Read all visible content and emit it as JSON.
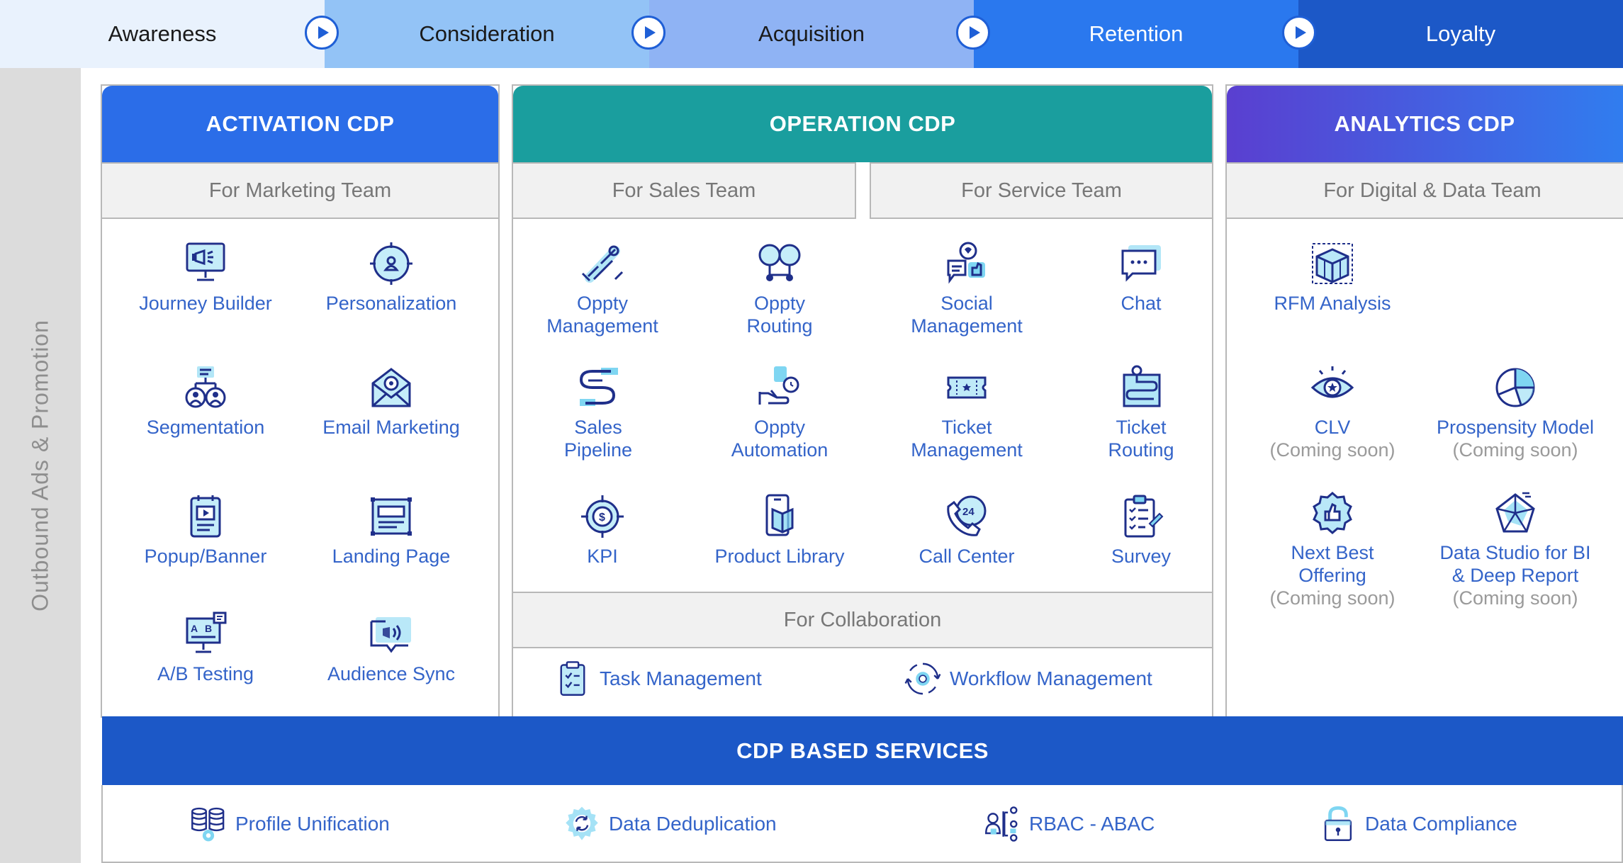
{
  "funnel": [
    {
      "label": "Awareness",
      "bg": "#e9f2fd",
      "fg": "#1a1a1a"
    },
    {
      "label": "Consideration",
      "bg": "#93c3f6",
      "fg": "#1a1a1a"
    },
    {
      "label": "Acquisition",
      "bg": "#8fb3f4",
      "fg": "#1a1a1a"
    },
    {
      "label": "Retention",
      "bg": "#2a78ee",
      "fg": "#ffffff"
    },
    {
      "label": "Loyalty",
      "bg": "#1c58c7",
      "fg": "#ffffff"
    }
  ],
  "side_label": "Outbound Ads & Promotion",
  "activation": {
    "title": "ACTIVATION CDP",
    "team": "For Marketing Team",
    "color": "#2b6de8",
    "items": [
      {
        "label": "Journey Builder",
        "icon": "monitor-megaphone-icon"
      },
      {
        "label": "Personalization",
        "icon": "user-target-icon"
      },
      {
        "label": "Segmentation",
        "icon": "segmentation-users-icon"
      },
      {
        "label": "Email Marketing",
        "icon": "email-at-icon"
      },
      {
        "label": "Popup/Banner",
        "icon": "popup-banner-icon"
      },
      {
        "label": "Landing Page",
        "icon": "landing-page-icon"
      },
      {
        "label": "A/B Testing",
        "icon": "ab-testing-icon"
      },
      {
        "label": "Audience Sync",
        "icon": "audience-sync-icon"
      }
    ]
  },
  "operation": {
    "title": "OPERATION CDP",
    "sales_team": "For Sales Team",
    "service_team": "For Service Team",
    "collab_team": "For Collaboration",
    "color": "#1a9e9e",
    "items": [
      {
        "label": "Oppty Management",
        "icon": "handshake-icon"
      },
      {
        "label": "Oppty Routing",
        "icon": "routing-icon"
      },
      {
        "label": "Social Management",
        "icon": "social-thumbs-icon"
      },
      {
        "label": "Chat",
        "icon": "chat-icon"
      },
      {
        "label": "Sales Pipeline",
        "icon": "pipeline-icon"
      },
      {
        "label": "Oppty Automation",
        "icon": "automation-hand-icon"
      },
      {
        "label": "Ticket Management",
        "icon": "ticket-icon"
      },
      {
        "label": "Ticket Routing",
        "icon": "ticket-routing-icon"
      },
      {
        "label": "KPI",
        "icon": "kpi-target-icon"
      },
      {
        "label": "Product Library",
        "icon": "product-library-icon"
      },
      {
        "label": "Call Center",
        "icon": "call-center-24-icon"
      },
      {
        "label": "Survey",
        "icon": "survey-clipboard-icon"
      }
    ],
    "collab": [
      {
        "label": "Task Management",
        "icon": "task-clipboard-icon"
      },
      {
        "label": "Workflow Management",
        "icon": "workflow-cycle-icon"
      }
    ]
  },
  "analytics": {
    "title": "ANALYTICS CDP",
    "team": "For Digital & Data Team",
    "color_from": "#5a3fd0",
    "color_to": "#2f7ff0",
    "items": [
      {
        "label": "RFM Analysis",
        "icon": "rfm-cube-icon",
        "note": ""
      },
      {
        "label": "CLV",
        "icon": "clv-eye-icon",
        "note": "(Coming soon)"
      },
      {
        "label": "Prospensity Model",
        "icon": "pie-chart-icon",
        "note": "(Coming soon)"
      },
      {
        "label": "Next Best Offering",
        "icon": "badge-thumbs-icon",
        "note": "(Coming soon)"
      },
      {
        "label": "Data Studio for BI & Deep Report",
        "icon": "radar-chart-icon",
        "note": "(Coming soon)"
      }
    ]
  },
  "services": {
    "title": "CDP BASED SERVICES",
    "color": "#1c58c7",
    "items": [
      {
        "label": "Profile Unification",
        "icon": "database-gear-icon"
      },
      {
        "label": "Data Deduplication",
        "icon": "dedup-gear-icon"
      },
      {
        "label": "RBAC - ABAC",
        "icon": "access-control-icon"
      },
      {
        "label": "Data Compliance",
        "icon": "padlock-icon"
      }
    ]
  },
  "colors": {
    "text_blue": "#3464c9",
    "icon_navy": "#1f2f8a",
    "icon_cyan": "#7fd6f2",
    "muted": "#9a9a9a"
  }
}
